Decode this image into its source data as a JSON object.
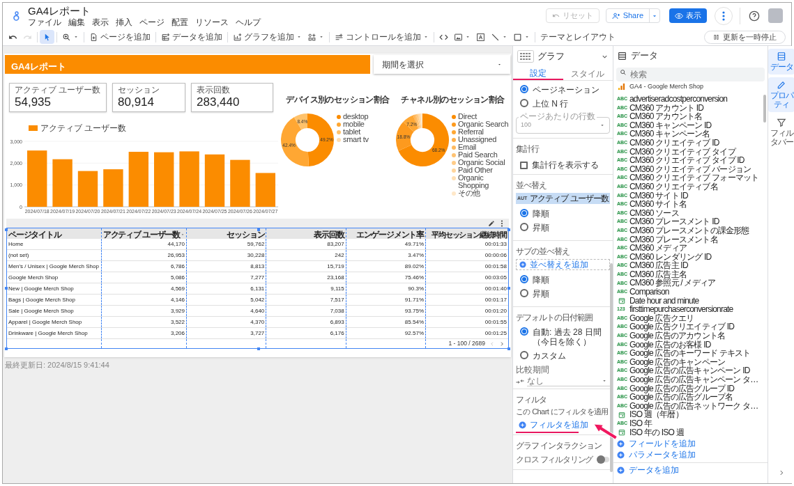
{
  "app": {
    "title": "GA4レポート",
    "menu": [
      "ファイル",
      "編集",
      "表示",
      "挿入",
      "ページ",
      "配置",
      "リソース",
      "ヘルプ"
    ],
    "reset": {
      "label": "リセット",
      "disabled": true
    },
    "share": "Share",
    "view": "表示"
  },
  "toolbar": {
    "groups": [
      [
        {
          "kind": "undo",
          "dropdown": false,
          "selected": false,
          "disabled": false
        },
        {
          "kind": "redo",
          "dropdown": false,
          "selected": false,
          "disabled": true
        }
      ],
      [
        {
          "kind": "select",
          "dropdown": false,
          "selected": true,
          "disabled": false
        }
      ],
      [
        {
          "kind": "zoom",
          "dropdown": true,
          "selected": false,
          "disabled": false
        }
      ],
      [
        {
          "kind": "add_page",
          "label": "ページを追加",
          "dropdown": false,
          "selected": false,
          "disabled": false
        }
      ],
      [
        {
          "kind": "add_data",
          "label": "データを追加",
          "dropdown": false,
          "selected": false,
          "disabled": false
        }
      ],
      [
        {
          "kind": "add_chart",
          "label": "グラフを追加",
          "dropdown": true,
          "selected": false,
          "disabled": false
        },
        {
          "kind": "components",
          "dropdown": true,
          "selected": false,
          "disabled": false
        }
      ],
      [
        {
          "kind": "add_control",
          "label": "コントロールを追加",
          "dropdown": true,
          "selected": false,
          "disabled": false
        }
      ],
      [
        {
          "kind": "code",
          "dropdown": false,
          "selected": false,
          "disabled": false
        },
        {
          "kind": "image",
          "dropdown": true,
          "selected": false,
          "disabled": false
        },
        {
          "kind": "textbox",
          "dropdown": false,
          "selected": false,
          "disabled": false
        },
        {
          "kind": "line",
          "dropdown": true,
          "selected": false,
          "disabled": false
        },
        {
          "kind": "shape",
          "dropdown": true,
          "selected": false,
          "disabled": false
        }
      ],
      [
        {
          "kind": "theme",
          "label": "テーマとレイアウト",
          "dropdown": false,
          "selected": false,
          "disabled": false
        }
      ]
    ],
    "pause_button": "更新を一時停止"
  },
  "report": {
    "title": "GA4レポート",
    "date_selector": "期間を選択",
    "scorecards": [
      {
        "label": "アクティブ ユーザー数",
        "value": "54,935"
      },
      {
        "label": "セッション",
        "value": "80,914"
      },
      {
        "label": "表示回数",
        "value": "283,440"
      }
    ],
    "bar_chart": {
      "chart_data": {
        "type": "bar",
        "categories": [
          "2024/07/18",
          "2024/07/19",
          "2024/07/20",
          "2024/07/21",
          "2024/07/22",
          "2024/07/23",
          "2024/07/24",
          "2024/07/25",
          "2024/07/26",
          "2024/07/27"
        ],
        "series": [
          {
            "name": "アクティブ ユーザー数",
            "color": "#fb8c00",
            "values": [
              2580,
              2180,
              1640,
              1720,
              2520,
              2500,
              2540,
              2400,
              2150,
              1550
            ]
          }
        ],
        "ylim": [
          0,
          3000
        ],
        "yticks": [
          {
            "value": 0,
            "label": "0"
          },
          {
            "value": 1000,
            "label": "1,000"
          },
          {
            "value": 2000,
            "label": "2,000"
          },
          {
            "value": 3000,
            "label": "3,000"
          }
        ]
      }
    },
    "device_chart": {
      "chart_data": {
        "type": "donut",
        "title": "デバイス別のセッション割合",
        "categories": [
          "desktop",
          "mobile",
          "tablet",
          "smart tv"
        ],
        "values": [
          49.2,
          42.4,
          8.4,
          null
        ],
        "legend": "right",
        "colors": [
          "#fb8c00",
          "#ffa733",
          "#ffc26b",
          "#ffdcae"
        ],
        "value_labels": [
          "49.2%",
          "42.4%",
          "8.4%",
          null
        ]
      }
    },
    "channel_chart": {
      "chart_data": {
        "type": "donut",
        "title": "チャネル別のセッション割合",
        "categories": [
          "Direct",
          "Organic Search",
          "Referral",
          "Unassigned",
          "Email",
          "Paid Search",
          "Organic Social",
          "Paid Other",
          "Organic Shopping",
          "その他"
        ],
        "values": [
          68.2,
          18.8,
          7.2,
          0.9,
          0.9,
          0.8,
          0.8,
          0.8,
          0.8,
          0.8
        ],
        "legend": "right",
        "colors": [
          "#fb8c00",
          "#fd9a1e",
          "#ffa733",
          "#ffb04a",
          "#ffb95e",
          "#ffc373",
          "#ffcc88",
          "#ffd59c",
          "#ffdfb3",
          "#ffe8c9"
        ],
        "value_labels": [
          "68.2%",
          "18.8%",
          "7.2%",
          null,
          null,
          null,
          null,
          null,
          null,
          null
        ]
      }
    },
    "table": {
      "columns": [
        {
          "label": "ページタイトル",
          "sorted": false
        },
        {
          "label": "アクティブ ユーザー数",
          "sorted": true
        },
        {
          "label": "セッション",
          "sorted": false
        },
        {
          "label": "表示回数",
          "sorted": false
        },
        {
          "label": "エンゲージメント率",
          "sorted": false
        },
        {
          "label": "平均セッション継続時間",
          "sorted": false
        }
      ],
      "rows": [
        [
          "Home",
          "44,170",
          "59,762",
          "83,207",
          "49.71%",
          "00:01:33"
        ],
        [
          "(not set)",
          "26,953",
          "30,228",
          "242",
          "3.47%",
          "00:00:06"
        ],
        [
          "Men's / Unisex | Google Merch Shop",
          "6,786",
          "8,813",
          "15,719",
          "89.02%",
          "00:01:58"
        ],
        [
          "Google Merch Shop",
          "5,086",
          "7,277",
          "23,168",
          "75.46%",
          "00:03:05"
        ],
        [
          "New | Google Merch Shop",
          "4,569",
          "6,131",
          "9,115",
          "90.3%",
          "00:01:40"
        ],
        [
          "Bags | Google Merch Shop",
          "4,146",
          "5,042",
          "7,517",
          "91.71%",
          "00:01:17"
        ],
        [
          "Sale | Google Merch Shop",
          "3,929",
          "4,640",
          "7,038",
          "93.75%",
          "00:01:20"
        ],
        [
          "Apparel | Google Merch Shop",
          "3,522",
          "4,370",
          "6,893",
          "85.54%",
          "00:01:55"
        ],
        [
          "Drinkware | Google Merch Shop",
          "3,206",
          "3,727",
          "6,176",
          "92.57%",
          "00:01:25"
        ]
      ],
      "pagination": "1 - 100 / 2689",
      "prev_disabled": true
    },
    "footer": "最終更新日: 2024/8/15 9:41:44"
  },
  "properties_panel": {
    "title": "グラフ",
    "tabs": [
      {
        "label": "設定",
        "selected": true
      },
      {
        "label": "スタイル",
        "selected": false
      }
    ],
    "table_mode": {
      "options": [
        {
          "label": "ページネーション",
          "selected": true
        },
        {
          "label": "上位 N 行",
          "selected": false
        }
      ],
      "rows_per_page": {
        "label": "ページあたりの行数",
        "value": "100"
      }
    },
    "summary_row": {
      "heading": "集計行",
      "checkbox": {
        "label": "集計行を表示する",
        "checked": false
      }
    },
    "sort": {
      "heading": "並べ替え",
      "field": {
        "badge": "AUT",
        "label": "アクティブ ユーザー数"
      },
      "order": [
        {
          "label": "降順",
          "selected": true
        },
        {
          "label": "昇順",
          "selected": false
        }
      ]
    },
    "secondary_sort": {
      "heading": "サブの並べ替え",
      "add_button": "並べ替えを追加",
      "order": [
        {
          "label": "降順",
          "selected": true
        },
        {
          "label": "昇順",
          "selected": false
        }
      ]
    },
    "date_range": {
      "heading": "デフォルトの日付範囲",
      "options": [
        {
          "label": "自動: 過去 28 日間（今日を除く）",
          "selected": true
        },
        {
          "label": "カスタム",
          "selected": false
        }
      ],
      "comparison": {
        "label": "比較期間",
        "value": "なし"
      }
    },
    "filter": {
      "heading": "フィルタ",
      "description": "この Chart にフィルタを適用",
      "add_button": "フィルタを追加"
    },
    "interaction": {
      "heading": "グラフ インタラクション",
      "cross_filtering": {
        "label": "クロス フィルタリング",
        "on": false
      }
    }
  },
  "data_panel": {
    "title": "データ",
    "search": {
      "placeholder": "検索"
    },
    "source": "GA4 - Google Merch Shop",
    "fields": [
      {
        "kind": "text",
        "badge": "ABC",
        "label": "advertiseradcostperconversion"
      },
      {
        "kind": "text",
        "badge": "ABC",
        "label": "CM360 アカウント ID"
      },
      {
        "kind": "text",
        "badge": "ABC",
        "label": "CM360 アカウント名"
      },
      {
        "kind": "text",
        "badge": "ABC",
        "label": "CM360 キャンペーン ID"
      },
      {
        "kind": "text",
        "badge": "ABC",
        "label": "CM360 キャンペーン名"
      },
      {
        "kind": "text",
        "badge": "ABC",
        "label": "CM360 クリエイティブ ID"
      },
      {
        "kind": "text",
        "badge": "ABC",
        "label": "CM360 クリエイティブ タイプ"
      },
      {
        "kind": "text",
        "badge": "ABC",
        "label": "CM360 クリエイティブ タイプ ID"
      },
      {
        "kind": "text",
        "badge": "ABC",
        "label": "CM360 クリエイティブ バージョン"
      },
      {
        "kind": "text",
        "badge": "ABC",
        "label": "CM360 クリエイティブ フォーマット"
      },
      {
        "kind": "text",
        "badge": "ABC",
        "label": "CM360 クリエイティブ名"
      },
      {
        "kind": "text",
        "badge": "ABC",
        "label": "CM360 サイト ID"
      },
      {
        "kind": "text",
        "badge": "ABC",
        "label": "CM360 サイト名"
      },
      {
        "kind": "text",
        "badge": "ABC",
        "label": "CM360 ソース"
      },
      {
        "kind": "text",
        "badge": "ABC",
        "label": "CM360 プレースメント ID"
      },
      {
        "kind": "text",
        "badge": "ABC",
        "label": "CM360 プレースメントの課金形態"
      },
      {
        "kind": "text",
        "badge": "ABC",
        "label": "CM360 プレースメント名"
      },
      {
        "kind": "text",
        "badge": "ABC",
        "label": "CM360 メディア"
      },
      {
        "kind": "text",
        "badge": "ABC",
        "label": "CM360 レンダリング ID"
      },
      {
        "kind": "text",
        "badge": "ABC",
        "label": "CM360 広告主 ID"
      },
      {
        "kind": "text",
        "badge": "ABC",
        "label": "CM360 広告主名"
      },
      {
        "kind": "text",
        "badge": "ABC",
        "label": "CM360 参照元 / メディア"
      },
      {
        "kind": "text",
        "badge": "ABC",
        "label": "Comparison"
      },
      {
        "kind": "date",
        "label": "Date hour and minute"
      },
      {
        "kind": "number",
        "badge": "123",
        "label": "firsttimepurchaserconversionrate"
      },
      {
        "kind": "text",
        "badge": "ABC",
        "label": "Google 広告クエリ"
      },
      {
        "kind": "text",
        "badge": "ABC",
        "label": "Google 広告クリエイティブ ID"
      },
      {
        "kind": "text",
        "badge": "ABC",
        "label": "Google 広告のアカウント名"
      },
      {
        "kind": "text",
        "badge": "ABC",
        "label": "Google 広告のお客様 ID"
      },
      {
        "kind": "text",
        "badge": "ABC",
        "label": "Google 広告のキーワード テキスト"
      },
      {
        "kind": "text",
        "badge": "ABC",
        "label": "Google 広告のキャンペーン"
      },
      {
        "kind": "text",
        "badge": "ABC",
        "label": "Google 広告の広告キャンペーン ID"
      },
      {
        "kind": "text",
        "badge": "ABC",
        "label": "Google 広告の広告キャンペーン タ…"
      },
      {
        "kind": "text",
        "badge": "ABC",
        "label": "Google 広告の広告グループ ID"
      },
      {
        "kind": "text",
        "badge": "ABC",
        "label": "Google 広告の広告グループ名"
      },
      {
        "kind": "text",
        "badge": "ABC",
        "label": "Google 広告の広告ネットワーク タ…"
      },
      {
        "kind": "date",
        "label": "ISO 週（年暦）"
      },
      {
        "kind": "text",
        "badge": "ABC",
        "label": "ISO 年"
      },
      {
        "kind": "date",
        "label": "ISO 年の ISO 週"
      }
    ],
    "add_field": "フィールドを追加",
    "add_parameter": "パラメータを追加",
    "add_data": "データを追加"
  },
  "rail": [
    {
      "kind": "data",
      "label": "データ",
      "selected": true
    },
    {
      "kind": "properties",
      "label": "プロパティ",
      "selected": true
    },
    {
      "kind": "filter_bar",
      "label": "フィルタバー",
      "selected": false
    }
  ]
}
